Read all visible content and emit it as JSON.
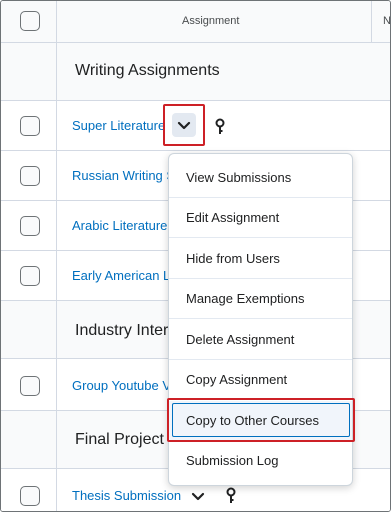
{
  "header": {
    "assignment_col": "Assignment",
    "next_col": "N"
  },
  "rows": [
    {
      "type": "section",
      "title": "Writing Assignments"
    },
    {
      "type": "item",
      "label": "Super Literature"
    },
    {
      "type": "item",
      "label": "Russian Writing S"
    },
    {
      "type": "item",
      "label": "Arabic Literature"
    },
    {
      "type": "item",
      "label": "Early American L"
    },
    {
      "type": "section",
      "title": "Industry Interv"
    },
    {
      "type": "item",
      "label": "Group Youtube V"
    },
    {
      "type": "section",
      "title": "Final Project"
    },
    {
      "type": "item",
      "label": "Thesis Submission"
    }
  ],
  "menu": {
    "items": [
      "View Submissions",
      "Edit Assignment",
      "Hide from Users",
      "Manage Exemptions",
      "Delete Assignment",
      "Copy Assignment",
      "Copy to Other Courses",
      "Submission Log"
    ],
    "highlighted": "Copy to Other Courses"
  },
  "colors": {
    "link": "#006fbf",
    "highlight_border": "#cd2026",
    "focus_border": "#006fbf"
  }
}
